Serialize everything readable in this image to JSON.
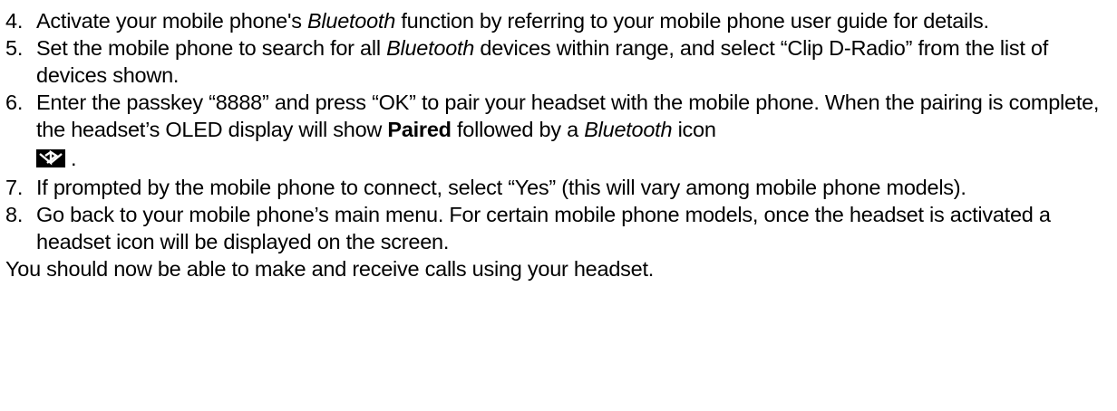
{
  "steps": [
    {
      "number": "4.",
      "parts": [
        {
          "text": "Activate your mobile phone's ",
          "style": ""
        },
        {
          "text": "Bluetooth",
          "style": "em"
        },
        {
          "text": " function by referring to your mobile phone user guide for details.",
          "style": ""
        }
      ]
    },
    {
      "number": "5.",
      "parts": [
        {
          "text": "Set the mobile phone to search for all ",
          "style": ""
        },
        {
          "text": "Bluetooth",
          "style": "em"
        },
        {
          "text": " devices within range, and select “Clip D-Radio” from the list of devices shown.",
          "style": ""
        }
      ]
    },
    {
      "number": "6.",
      "parts": [
        {
          "text": "Enter the passkey “8888” and press “OK” to pair your headset with the mobile phone. When the pairing is complete, the headset’s OLED display will show ",
          "style": ""
        },
        {
          "text": "Paired",
          "style": "strong"
        },
        {
          "text": " followed by a ",
          "style": ""
        },
        {
          "text": "Bluetooth",
          "style": "em"
        },
        {
          "text": " icon",
          "style": ""
        }
      ],
      "icon": "bluetooth-oled-icon",
      "after_icon": "."
    },
    {
      "number": "7.",
      "parts": [
        {
          "text": "If prompted by the mobile phone to connect, select “Yes” (this will vary among mobile phone models).",
          "style": ""
        }
      ]
    },
    {
      "number": "8.",
      "parts": [
        {
          "text": "Go back to your mobile phone’s main menu. For certain mobile phone models, once the headset is activated a headset icon will be displayed on the screen.",
          "style": ""
        }
      ]
    }
  ],
  "closing": "You should now be able to make and receive calls using your headset."
}
